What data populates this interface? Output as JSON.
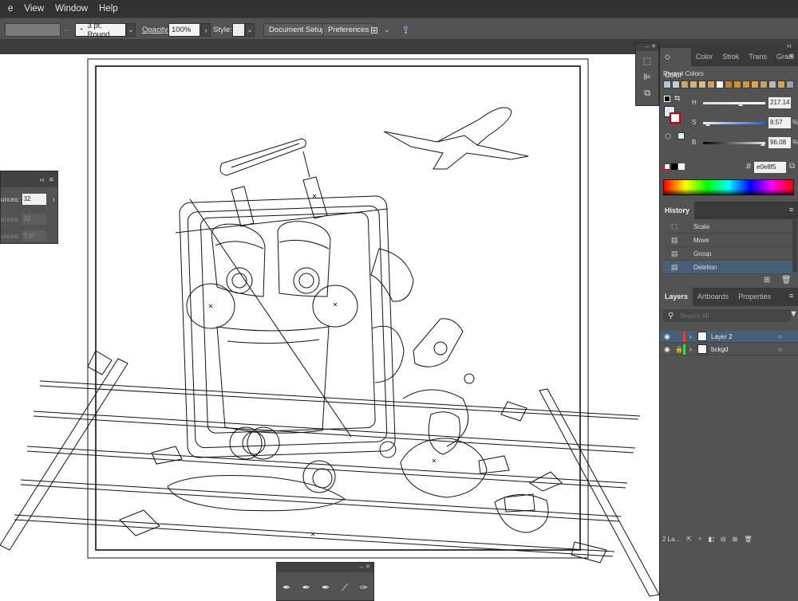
{
  "menu": {
    "items": [
      "e",
      "View",
      "Window",
      "Help"
    ]
  },
  "control_bar": {
    "stroke_profile": "3 pt. Round",
    "opacity_label": "Opacity:",
    "opacity_value": "100%",
    "style_label": "Style:",
    "document_setup": "Document Setup",
    "preferences": "Preferences"
  },
  "color_panel": {
    "tabs": [
      "Color",
      "Color",
      "Strok",
      "Trans",
      "Gradi"
    ],
    "recent_colors_label": "Recent Colors",
    "swatches": [
      "#b9c2cf",
      "#c9cdd6",
      "#c9a96e",
      "#d5b27a",
      "#d9b98a",
      "#c8a162",
      "#ffffff",
      "#b8862f",
      "#c9922e",
      "#c89a45",
      "#d4a75a",
      "#c4a36c",
      "#b9babf",
      "#d1a35a",
      "#9aa0ad"
    ],
    "h_label": "H",
    "h_value": "217.14",
    "s_label": "S",
    "s_value": "8.57",
    "s_unit": "%",
    "b_label": "B",
    "b_value": "96.08",
    "b_unit": "%",
    "hex_prefix": "#",
    "hex_value": "e0e8f5"
  },
  "history_panel": {
    "title": "History",
    "items": [
      {
        "label": "Scale"
      },
      {
        "label": "Move"
      },
      {
        "label": "Group"
      },
      {
        "label": "Deletion"
      }
    ]
  },
  "layers_panel": {
    "tabs": [
      "Layers",
      "Artboards",
      "Properties"
    ],
    "search_placeholder": "Search All",
    "layers": [
      {
        "name": "Layer 2",
        "color": "#e04343"
      },
      {
        "name": "bckgd",
        "color": "#4bd14b"
      }
    ],
    "count_label": "2 La..."
  },
  "float_panel": {
    "row1_label": "unces:",
    "row1_value": "32",
    "row2_label": "unces:",
    "row2_value": "32",
    "row3_label": "unces:",
    "row3_value": "5 pt"
  }
}
